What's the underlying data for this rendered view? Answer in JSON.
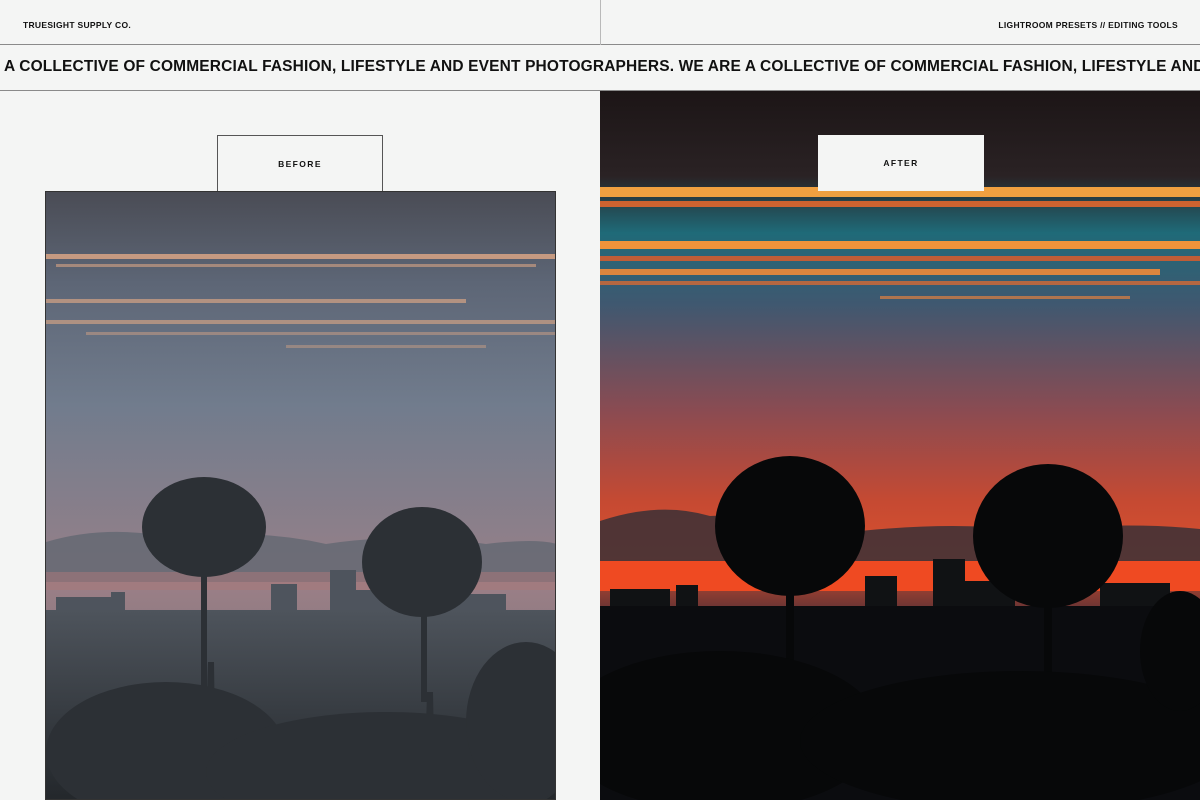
{
  "header": {
    "brand": "TRUESIGHT SUPPLY CO.",
    "tagline": "LIGHTROOM PRESETS // EDITING TOOLS"
  },
  "marquee": {
    "text": "A COLLECTIVE OF COMMERCIAL FASHION, LIFESTYLE AND EVENT PHOTOGRAPHERS. WE ARE A COLLECTIVE OF COMMERCIAL FASHION, LIFESTYLE AND EVENT PHOTOGRAPHERS."
  },
  "before": {
    "label": "BEFORE"
  },
  "after": {
    "label": "AFTER"
  },
  "colors": {
    "background": "#f4f5f4",
    "text": "#111111",
    "rule": "#8a8a8a"
  }
}
